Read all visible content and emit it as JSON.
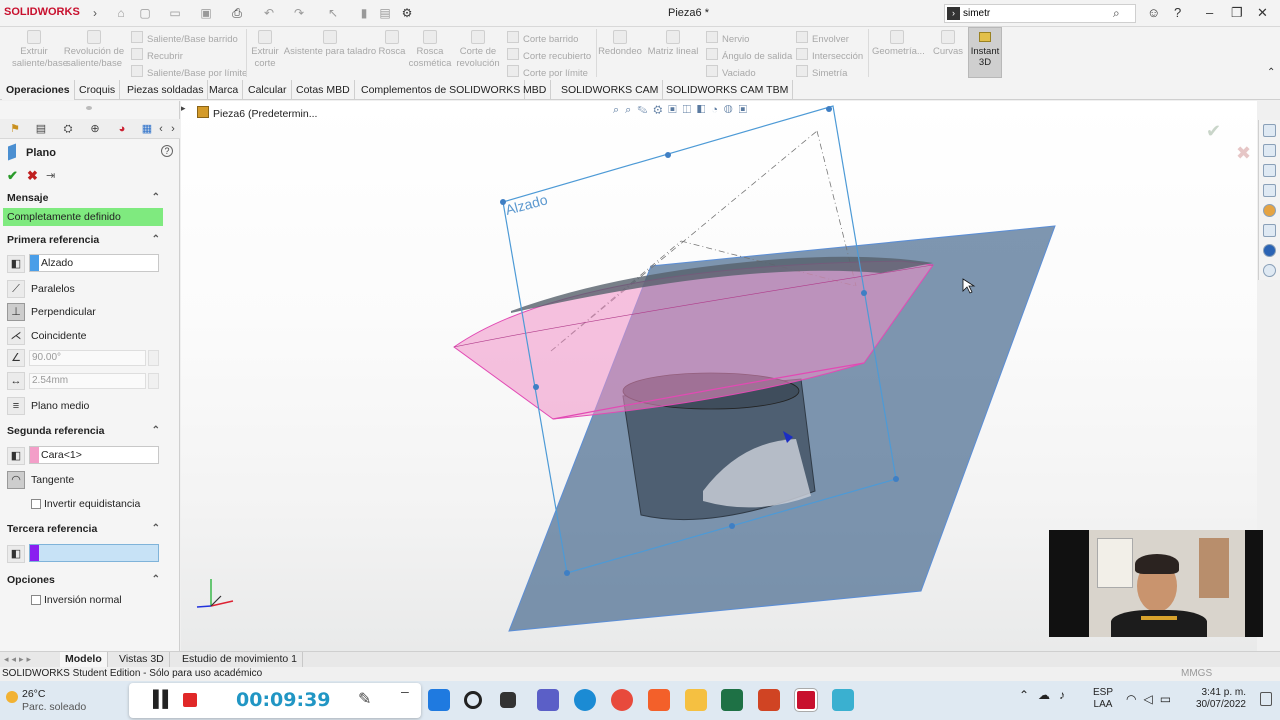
{
  "app": {
    "logo": "SOLIDWORKS",
    "doc_title": "Pieza6 *",
    "search_value": "simetr"
  },
  "ribbon": {
    "extruir": "Extruir saliente/base",
    "revolucion": "Revolución de saliente/base",
    "saliente_barrido": "Saliente/Base barrido",
    "recubrir": "Recubrir",
    "saliente_limite": "Saliente/Base por límite",
    "extruir_corte": "Extruir corte",
    "asistente": "Asistente para taladro",
    "rosca": "Rosca",
    "rosca_cosmetica": "Rosca cosmética",
    "corte_revolucion": "Corte de revolución",
    "corte_barrido": "Corte barrido",
    "corte_recubierto": "Corte recubierto",
    "corte_limite": "Corte por límite",
    "redondeo": "Redondeo",
    "matriz": "Matriz lineal",
    "nervio": "Nervio",
    "angulo": "Ángulo de salida",
    "vaciado": "Vaciado",
    "envolver": "Envolver",
    "interseccion": "Intersección",
    "simetria": "Simetría",
    "geometria": "Geometría...",
    "curvas": "Curvas",
    "instant3d": "Instant 3D"
  },
  "tabs": [
    "Operaciones",
    "Croquis",
    "Piezas soldadas",
    "Marca",
    "Calcular",
    "Cotas MBD",
    "Complementos de SOLIDWORKS",
    "MBD",
    "SOLIDWORKS CAM",
    "SOLIDWORKS CAM TBM"
  ],
  "pm": {
    "title": "Plano",
    "help": "?",
    "mensaje_hdr": "Mensaje",
    "mensaje": "Completamente definido",
    "primera_hdr": "Primera referencia",
    "primera_value": "Alzado",
    "paralelos": "Paralelos",
    "perpendicular": "Perpendicular",
    "coincidente": "Coincidente",
    "angle": "90.00°",
    "distance": "2.54mm",
    "plano_medio": "Plano medio",
    "segunda_hdr": "Segunda referencia",
    "segunda_value": "Cara<1>",
    "tangente": "Tangente",
    "invertir": "Invertir equidistancia",
    "tercera_hdr": "Tercera referencia",
    "tercera_value": "",
    "opciones_hdr": "Opciones",
    "inversion": "Inversión normal"
  },
  "viewport": {
    "crumb": "Pieza6  (Predetermin...",
    "plane_label": "Alzado"
  },
  "bottom_tabs": [
    "Modelo",
    "Vistas 3D",
    "Estudio de movimiento 1"
  ],
  "status": {
    "text": "SOLIDWORKS Student Edition - Sólo para uso académico",
    "units": "MMGS"
  },
  "taskbar": {
    "temp": "26°C",
    "weather": "Parc. soleado",
    "rec_time": "00:09:39",
    "lang1": "ESP",
    "lang2": "LAA",
    "time": "3:41 p. m.",
    "date": "30/07/2022"
  },
  "colors": {
    "message_ok": "#7fea7f",
    "first_ref": "#4a9ee8",
    "second_ref": "#f39ec8",
    "third_ref": "#8a1ef0",
    "third_field": "#c7e2f6"
  }
}
